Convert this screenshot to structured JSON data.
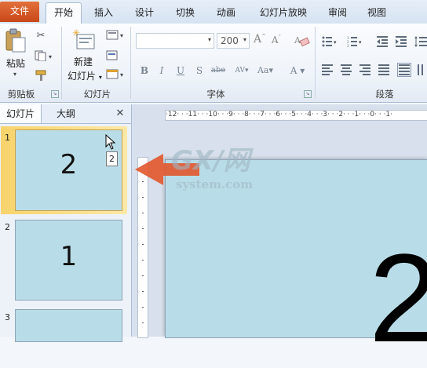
{
  "tabs": {
    "file": "文件",
    "home": "开始",
    "insert": "插入",
    "design": "设计",
    "transitions": "切换",
    "animations": "动画",
    "slideshow": "幻灯片放映",
    "review": "审阅",
    "view": "视图"
  },
  "ribbon": {
    "clipboard": {
      "paste_label": "粘贴",
      "group_label": "剪贴板"
    },
    "slides": {
      "new_slide_label_1": "新建",
      "new_slide_label_2": "幻灯片",
      "group_label": "幻灯片"
    },
    "font": {
      "font_name": "",
      "font_size": "200",
      "group_label": "字体"
    },
    "paragraph": {
      "group_label": "段落"
    }
  },
  "left_pane": {
    "tab_slides": "幻灯片",
    "tab_outline": "大纲",
    "close": "✕",
    "tooltip": "2",
    "slides": [
      {
        "number": "1",
        "text": "2"
      },
      {
        "number": "2",
        "text": "1"
      },
      {
        "number": "3",
        "text": ""
      }
    ]
  },
  "ruler": {
    "horizontal": "·12·  ·  ·11·  ·  ·10·  ·  ·9·  ·  ·8·  ·  ·7·  ·  ·6·  ·  ·5·  ·  ·4·  ·  ·3·  ·  ·2·  ·  ·1·  ·  ·0·  ·  ·1·"
  },
  "slide": {
    "text": "2"
  },
  "watermark": {
    "text": "GX/网",
    "subtext": "system.com"
  }
}
